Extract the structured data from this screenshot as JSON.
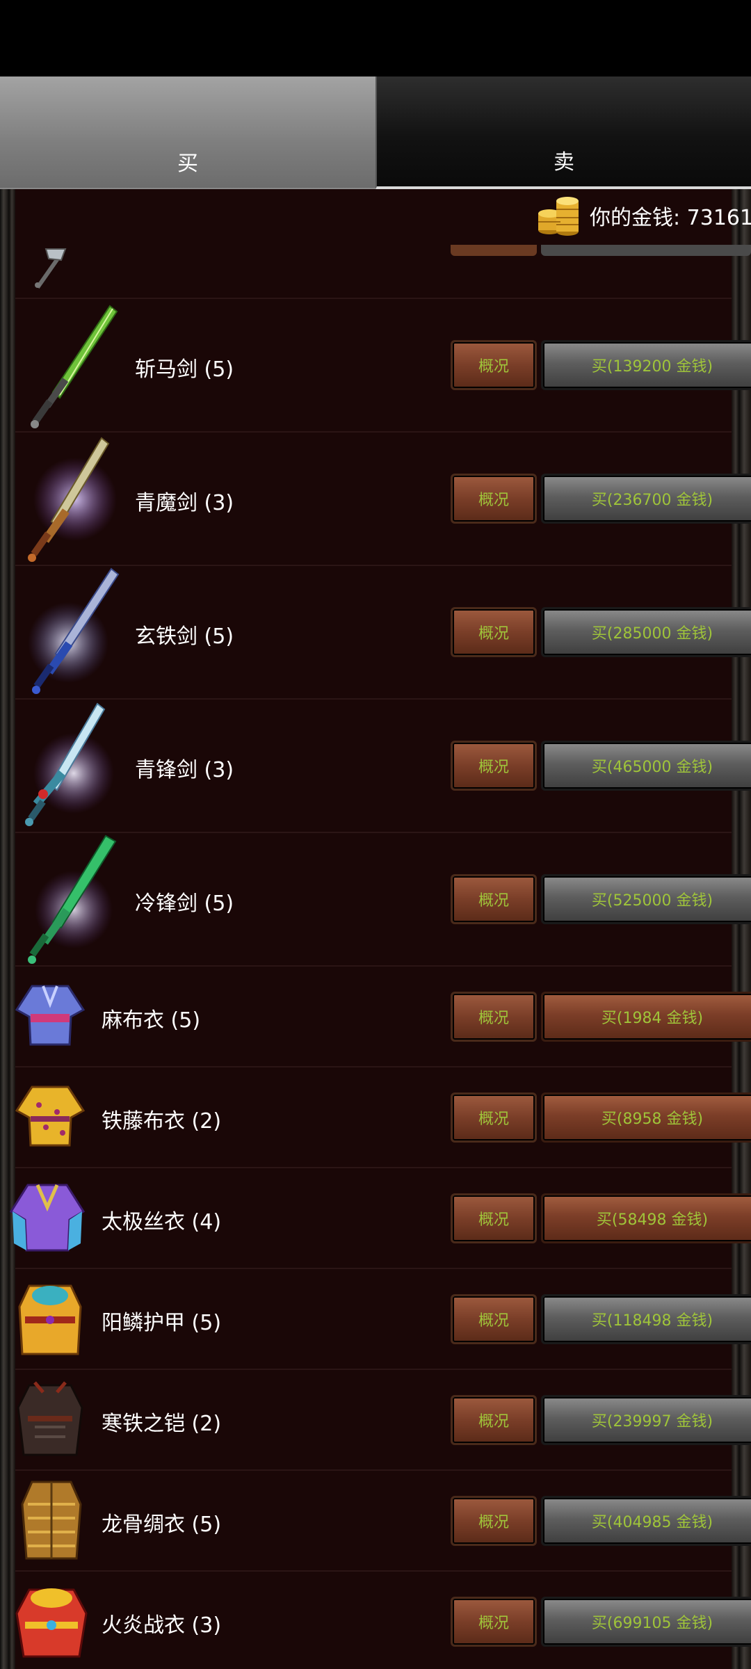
{
  "tabs": {
    "buy": "买",
    "sell": "卖"
  },
  "money": {
    "label": "你的金钱: 73161",
    "icon": "gold-coins-icon"
  },
  "buttons": {
    "info": "概况"
  },
  "items": [
    {
      "name": "斩马剑 (5)",
      "icon": "green-sword-icon",
      "price_label": "买(139200 金钱)",
      "buy_style": "grey"
    },
    {
      "name": "青魔剑 (3)",
      "icon": "gold-sword-icon",
      "price_label": "买(236700 金钱)",
      "buy_style": "grey"
    },
    {
      "name": "玄铁剑 (5)",
      "icon": "blue-sword-icon",
      "price_label": "买(285000 金钱)",
      "buy_style": "grey"
    },
    {
      "name": "青锋剑 (3)",
      "icon": "cyan-sword-icon",
      "price_label": "买(465000 金钱)",
      "buy_style": "grey"
    },
    {
      "name": "冷锋剑 (5)",
      "icon": "jade-sword-icon",
      "price_label": "买(525000 金钱)",
      "buy_style": "grey"
    },
    {
      "name": "麻布衣 (5)",
      "icon": "cloth-robe-icon",
      "price_label": "买(1984 金钱)",
      "buy_style": "wood"
    },
    {
      "name": "铁藤布衣 (2)",
      "icon": "yellow-robe-icon",
      "price_label": "买(8958 金钱)",
      "buy_style": "wood"
    },
    {
      "name": "太极丝衣 (4)",
      "icon": "silk-robe-icon",
      "price_label": "买(58498 金钱)",
      "buy_style": "wood"
    },
    {
      "name": "阳鳞护甲 (5)",
      "icon": "scale-armor-icon",
      "price_label": "买(118498 金钱)",
      "buy_style": "grey"
    },
    {
      "name": "寒铁之铠 (2)",
      "icon": "iron-armor-icon",
      "price_label": "买(239997 金钱)",
      "buy_style": "grey"
    },
    {
      "name": "龙骨绸衣 (5)",
      "icon": "dragon-bone-armor-icon",
      "price_label": "买(404985 金钱)",
      "buy_style": "grey"
    },
    {
      "name": "火炎战衣 (3)",
      "icon": "flame-armor-icon",
      "price_label": "买(699105 金钱)",
      "buy_style": "grey"
    }
  ]
}
